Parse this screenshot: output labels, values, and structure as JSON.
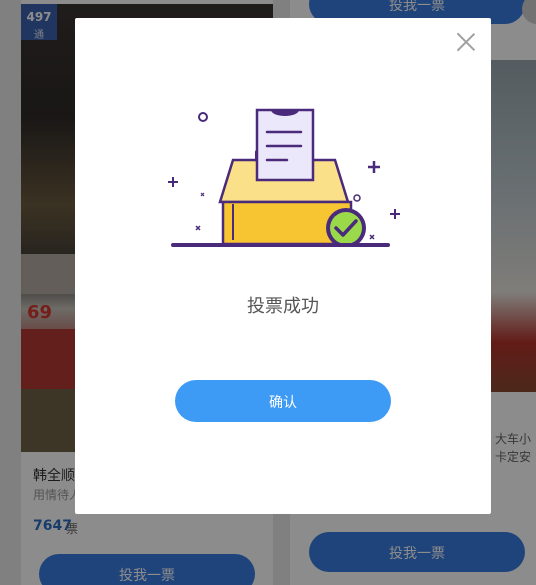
{
  "background": {
    "left_card": {
      "rank_number": "497",
      "rank_sub": "通",
      "route_number": "69",
      "title": "韩全顺",
      "description": "用情待人",
      "vote_count": "7647",
      "vote_unit": "票",
      "vote_button": "投我一票"
    },
    "right_card": {
      "top_vote_button": "投我一票",
      "text_line_1": "大车小",
      "text_line_2": "卡定安",
      "vote_button": "投我一票"
    }
  },
  "modal": {
    "message": "投票成功",
    "confirm_label": "确认"
  },
  "colors": {
    "accent_blue": "#3d9bf5",
    "ballot_purple": "#4a2a7a",
    "box_yellow": "#f7c531",
    "check_green": "#9ad94a"
  }
}
